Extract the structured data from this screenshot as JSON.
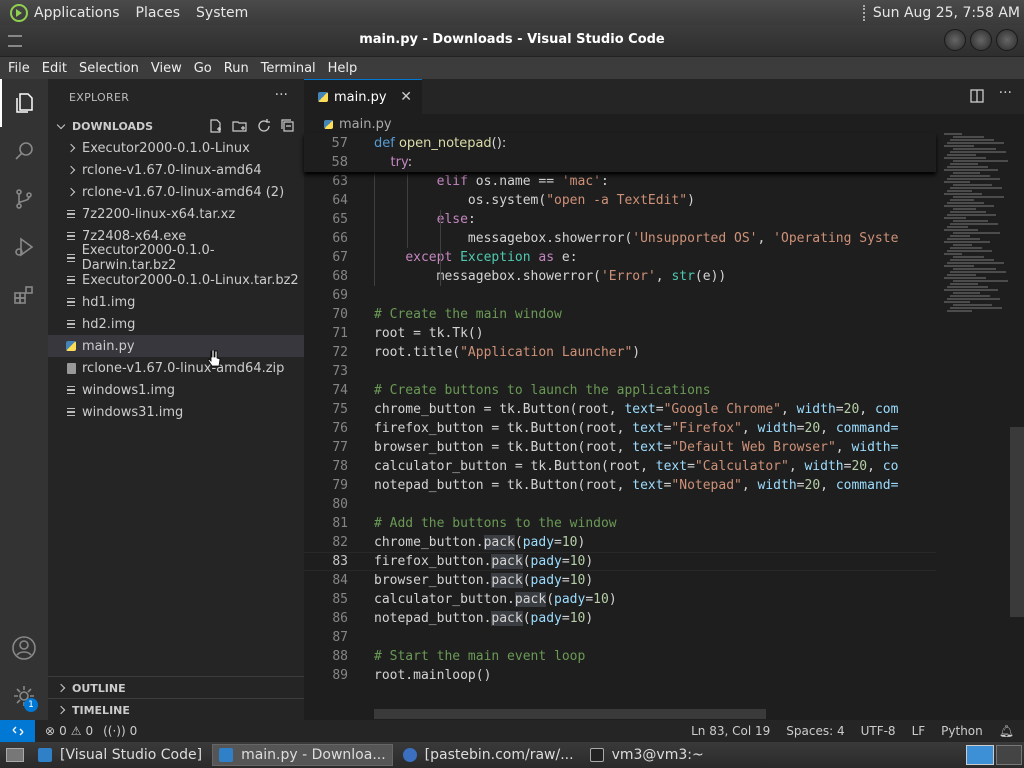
{
  "top_panel": {
    "menus": [
      "Applications",
      "Places",
      "System"
    ],
    "clock": "Sun Aug 25,  7:58 AM"
  },
  "window": {
    "title": "main.py - Downloads - Visual Studio Code"
  },
  "menubar": [
    "File",
    "Edit",
    "Selection",
    "View",
    "Go",
    "Run",
    "Terminal",
    "Help"
  ],
  "activity_bar": {
    "icons": [
      "explorer-icon",
      "search-icon",
      "source-control-icon",
      "run-debug-icon",
      "extensions-icon",
      "account-icon",
      "manage-gear-icon"
    ],
    "badge": "1"
  },
  "sidebar": {
    "title": "EXPLORER",
    "more": "···",
    "folder": "DOWNLOADS",
    "items": [
      {
        "label": "Executor2000-0.1.0-Linux",
        "type": "folder"
      },
      {
        "label": "rclone-v1.67.0-linux-amd64",
        "type": "folder"
      },
      {
        "label": "rclone-v1.67.0-linux-amd64 (2)",
        "type": "folder"
      },
      {
        "label": "7z2200-linux-x64.tar.xz",
        "type": "file"
      },
      {
        "label": "7z2408-x64.exe",
        "type": "file"
      },
      {
        "label": "Executor2000-0.1.0-Darwin.tar.bz2",
        "type": "file"
      },
      {
        "label": "Executor2000-0.1.0-Linux.tar.bz2",
        "type": "file"
      },
      {
        "label": "hd1.img",
        "type": "file"
      },
      {
        "label": "hd2.img",
        "type": "file"
      },
      {
        "label": "main.py",
        "type": "python"
      },
      {
        "label": "rclone-v1.67.0-linux-amd64.zip",
        "type": "zip"
      },
      {
        "label": "windows1.img",
        "type": "file"
      },
      {
        "label": "windows31.img",
        "type": "file"
      }
    ],
    "outline": "OUTLINE",
    "timeline": "TIMELINE"
  },
  "editor": {
    "tab": "main.py",
    "breadcrumb": "main.py",
    "sticky": [
      {
        "n": "57",
        "html": "<span class=\"def\">def</span> <span class=\"fn\">open_notepad</span>():"
      },
      {
        "n": "58",
        "html": "    <span class=\"kw\">try</span>:"
      }
    ],
    "lines": [
      {
        "n": "63",
        "html": "        <span class=\"kw\">elif</span> os.name == <span class=\"str\">'mac'</span>:"
      },
      {
        "n": "64",
        "html": "            os.system(<span class=\"str\">\"open -a TextEdit\"</span>)"
      },
      {
        "n": "65",
        "html": "        <span class=\"kw\">else</span>:"
      },
      {
        "n": "66",
        "html": "            messagebox.showerror(<span class=\"str\">'Unsupported OS'</span>, <span class=\"str\">'Operating Syste</span>"
      },
      {
        "n": "67",
        "html": "    <span class=\"kw\">except</span> <span class=\"cls\">Exception</span> <span class=\"kw\">as</span> e:"
      },
      {
        "n": "68",
        "html": "        messagebox.showerror(<span class=\"str\">'Error'</span>, <span class=\"cls\">str</span>(e))"
      },
      {
        "n": "69",
        "html": ""
      },
      {
        "n": "70",
        "html": "<span class=\"cm\"># Create the main window</span>"
      },
      {
        "n": "71",
        "html": "root = tk.Tk()"
      },
      {
        "n": "72",
        "html": "root.title(<span class=\"str\">\"Application Launcher\"</span>)"
      },
      {
        "n": "73",
        "html": ""
      },
      {
        "n": "74",
        "html": "<span class=\"cm\"># Create buttons to launch the applications</span>"
      },
      {
        "n": "75",
        "html": "chrome_button = tk.Button(root, <span class=\"var\">text</span>=<span class=\"str\">\"Google Chrome\"</span>, <span class=\"var\">width</span>=<span class=\"num\">20</span>, <span class=\"var\">com</span>"
      },
      {
        "n": "76",
        "html": "firefox_button = tk.Button(root, <span class=\"var\">text</span>=<span class=\"str\">\"Firefox\"</span>, <span class=\"var\">width</span>=<span class=\"num\">20</span>, <span class=\"var\">command=</span>"
      },
      {
        "n": "77",
        "html": "browser_button = tk.Button(root, <span class=\"var\">text</span>=<span class=\"str\">\"Default Web Browser\"</span>, <span class=\"var\">width=</span>"
      },
      {
        "n": "78",
        "html": "calculator_button = tk.Button(root, <span class=\"var\">text</span>=<span class=\"str\">\"Calculator\"</span>, <span class=\"var\">width</span>=<span class=\"num\">20</span>, <span class=\"var\">co</span>"
      },
      {
        "n": "79",
        "html": "notepad_button = tk.Button(root, <span class=\"var\">text</span>=<span class=\"str\">\"Notepad\"</span>, <span class=\"var\">width</span>=<span class=\"num\">20</span>, <span class=\"var\">command=</span>"
      },
      {
        "n": "80",
        "html": ""
      },
      {
        "n": "81",
        "html": "<span class=\"cm\"># Add the buttons to the window</span>"
      },
      {
        "n": "82",
        "html": "chrome_button.<span class=\"hl\">pack</span>(<span class=\"var\">pady</span>=<span class=\"num\">10</span>)"
      },
      {
        "n": "83",
        "html": "firefox_button.<span class=\"hl\">pack</span>(<span class=\"var\">pady</span>=<span class=\"num\">10</span>)"
      },
      {
        "n": "84",
        "html": "browser_button.<span class=\"hl\">pack</span>(<span class=\"var\">pady</span>=<span class=\"num\">10</span>)"
      },
      {
        "n": "85",
        "html": "calculator_button.<span class=\"hl\">pack</span>(<span class=\"var\">pady</span>=<span class=\"num\">10</span>)"
      },
      {
        "n": "86",
        "html": "notepad_button.<span class=\"hl\">pack</span>(<span class=\"var\">pady</span>=<span class=\"num\">10</span>)"
      },
      {
        "n": "87",
        "html": ""
      },
      {
        "n": "88",
        "html": "<span class=\"cm\"># Start the main event loop</span>"
      },
      {
        "n": "89",
        "html": "root.mainloop()"
      }
    ],
    "current_line": "83"
  },
  "statusbar": {
    "errors": "0",
    "warnings": "0",
    "ports": "0",
    "position": "Ln 83, Col 19",
    "spaces": "Spaces: 4",
    "encoding": "UTF-8",
    "eol": "LF",
    "language": "Python"
  },
  "taskbar": {
    "items": [
      "[Visual Studio Code]",
      "main.py - Downloa...",
      "[pastebin.com/raw/...",
      "vm3@vm3:~"
    ]
  }
}
